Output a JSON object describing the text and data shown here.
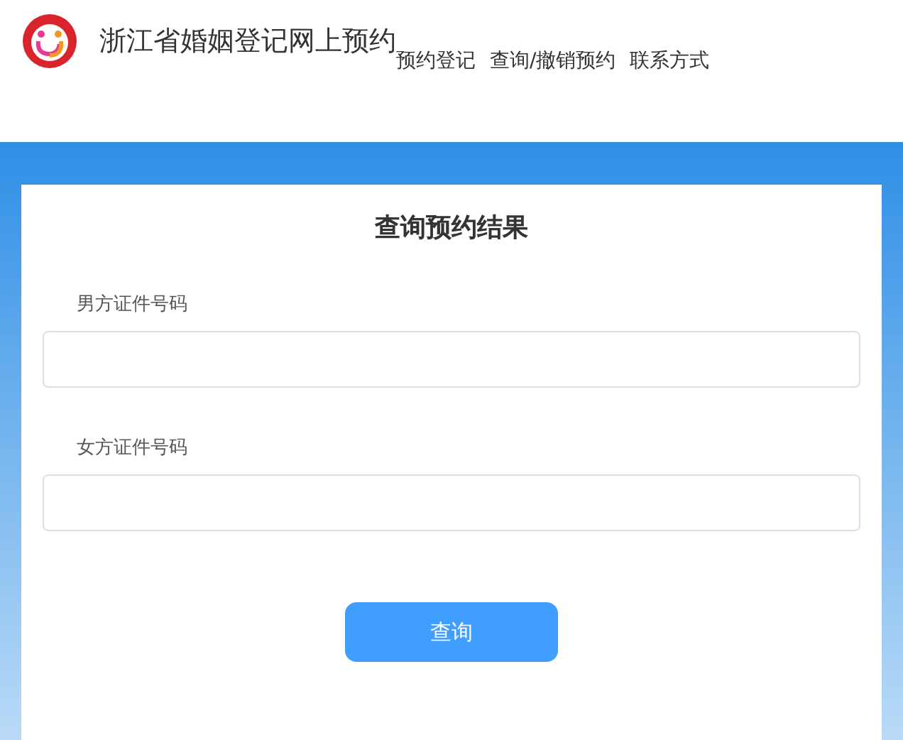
{
  "header": {
    "title": "浙江省婚姻登记网上预约",
    "nav": [
      "预约登记",
      "查询/撤销预约",
      "联系方式"
    ]
  },
  "form": {
    "title": "查询预约结果",
    "fields": [
      {
        "label": "男方证件号码"
      },
      {
        "label": "女方证件号码"
      }
    ],
    "button": "查询"
  }
}
